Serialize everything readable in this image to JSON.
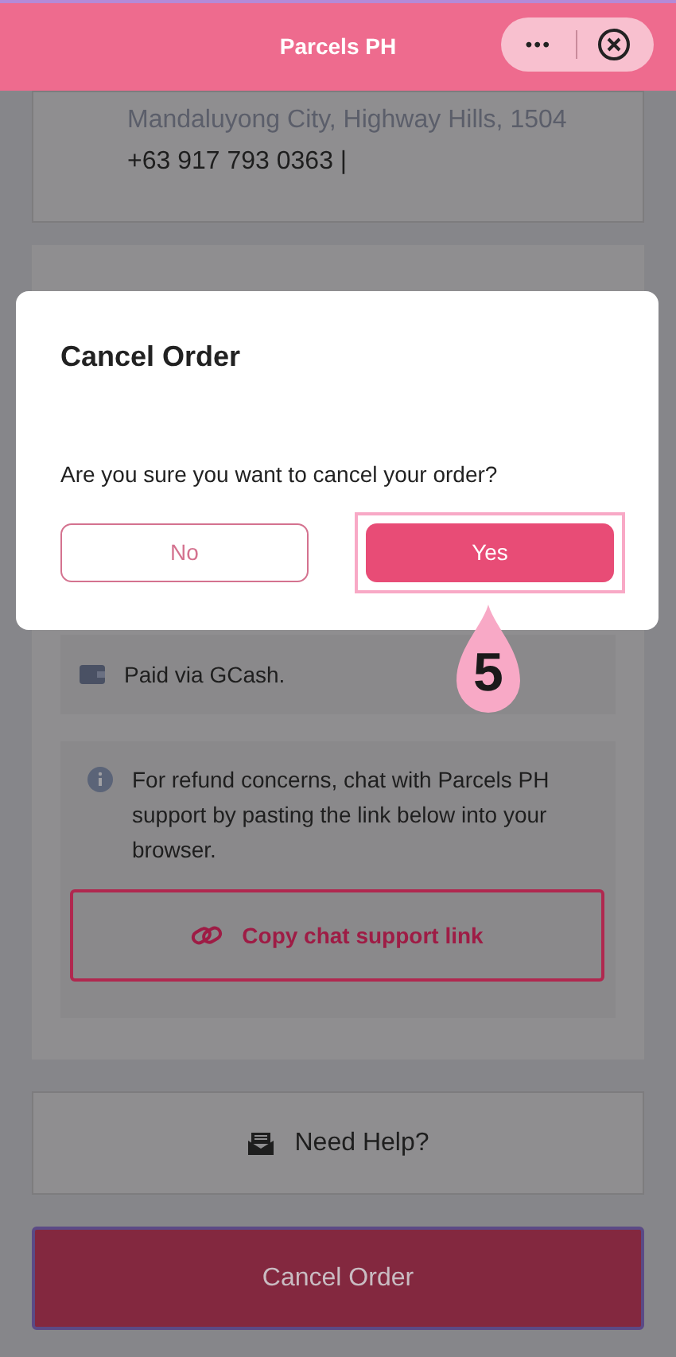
{
  "header": {
    "title": "Parcels PH",
    "more_label": "•••"
  },
  "address": {
    "line": "Mandaluyong City, Highway Hills, 1504",
    "phone": "+63 917 793 0363 |"
  },
  "payment": {
    "text": "Paid via GCash."
  },
  "refund": {
    "text": "For refund concerns, chat with Parcels PH support by pasting the link below into your browser.",
    "button": "Copy chat support link"
  },
  "help": {
    "label": "Need Help?"
  },
  "cancel_button": {
    "label": "Cancel Order",
    "disabled": true
  },
  "dialog": {
    "title": "Cancel Order",
    "message": "Are you sure you want to cancel your order?",
    "buttons": [
      {
        "label": "No",
        "kind": "outline",
        "highlighted": false
      },
      {
        "label": "Yes",
        "kind": "filled",
        "highlighted": true
      }
    ]
  },
  "step_marker": {
    "label": "5"
  }
}
